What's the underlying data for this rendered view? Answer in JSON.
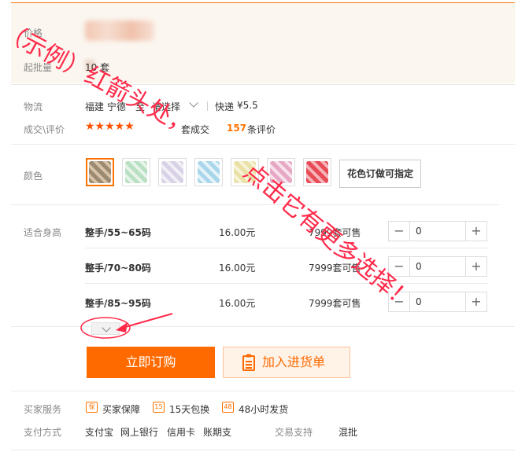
{
  "price": {
    "label": "价格",
    "min_order_label": "起批量",
    "min_order_value": "10 套"
  },
  "shipping": {
    "label": "物流",
    "from": "福建 宁德",
    "to": "至",
    "select": "请选择",
    "method": "快递",
    "fee": "¥5.5"
  },
  "deals": {
    "label": "成交\\评价",
    "rating_stars": "★★★★★",
    "sold_suffix": "套成交",
    "review_count": "157",
    "review_suffix": "条评价"
  },
  "color": {
    "label": "颜色",
    "swatches": [
      {
        "name": "swatch-1",
        "c1": "#9c8b73",
        "c2": "#d8c2a8"
      },
      {
        "name": "swatch-2",
        "c1": "#b9e0c3",
        "c2": "#e8f4ea"
      },
      {
        "name": "swatch-3",
        "c1": "#d9d2e6",
        "c2": "#f2eff6"
      },
      {
        "name": "swatch-4",
        "c1": "#a9d6ea",
        "c2": "#e6f3f8"
      },
      {
        "name": "swatch-5",
        "c1": "#e9e1a6",
        "c2": "#f6f3d9"
      },
      {
        "name": "swatch-6",
        "c1": "#e6a8c4",
        "c2": "#f7e3ec"
      },
      {
        "name": "swatch-7",
        "c1": "#e84c57",
        "c2": "#f5b5b9"
      }
    ],
    "custom_option": "花色订做可指定"
  },
  "size": {
    "label": "适合身高",
    "rows": [
      {
        "name": "整手/55~65码",
        "price": "16.00元",
        "stock": "7999套可售",
        "qty": "0"
      },
      {
        "name": "整手/70~80码",
        "price": "16.00元",
        "stock": "7999套可售",
        "qty": "0"
      },
      {
        "name": "整手/85~95码",
        "price": "16.00元",
        "stock": "7999套可售",
        "qty": "0"
      }
    ]
  },
  "actions": {
    "buy_now": "立即订购",
    "add_to_list": "加入进货单"
  },
  "services": {
    "label": "买家服务",
    "items": [
      {
        "icon": "保",
        "text": "买家保障"
      },
      {
        "icon": "15",
        "text": "15天包换"
      },
      {
        "icon": "48",
        "text": "48小时发货"
      }
    ]
  },
  "payment": {
    "label": "支付方式",
    "methods": [
      "支付宝",
      "网上银行",
      "信用卡",
      "账期支"
    ],
    "trade_label": "交易支持",
    "trade_value": "混批"
  },
  "annotation": {
    "line1": "（示例）红箭头处，",
    "line2": "点击它有更多选择！",
    "color": "#ff2a4a"
  },
  "colors": {
    "accent": "#ff6a00",
    "star": "#ff5000"
  }
}
